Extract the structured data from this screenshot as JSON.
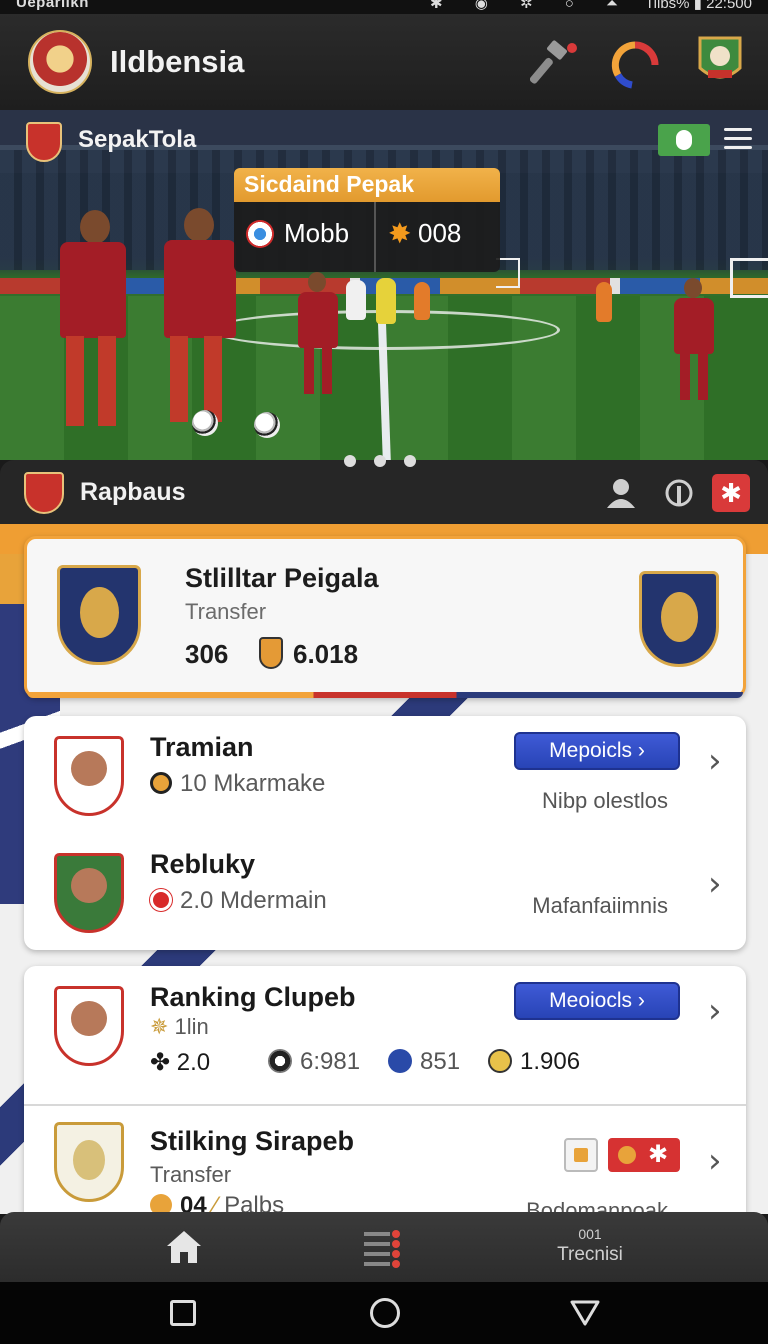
{
  "status_bar": {
    "carrier": "Uepariikn",
    "battery": "Tiibs%",
    "time": "22:500"
  },
  "header": {
    "title": "Ildbensia"
  },
  "hero": {
    "brand": "SepakTola",
    "match_card": {
      "title": "Sicdaind Pepak",
      "team": "Mobb",
      "score": "008"
    },
    "slide_count": 3
  },
  "section": {
    "title": "Rapbaus"
  },
  "featured": {
    "title": "Stlilltar Peigala",
    "subtitle": "Transfer",
    "count": "306",
    "value": "6.018"
  },
  "list": [
    {
      "title": "Tramian",
      "meta": "10 Mkarmake",
      "button": "Mepoicls  ›",
      "right_text": "Nibp olestlos"
    },
    {
      "title": "Rebluky",
      "meta": "2.0  Mdermain",
      "right_text": "Mafanfaiimnis"
    }
  ],
  "ranking": {
    "title": "Ranking Clupeb",
    "sub": "1lin",
    "button": "Meoiocls  ›",
    "stats": [
      "2.0",
      "6:981",
      "851",
      "1.906"
    ]
  },
  "striking": {
    "title": "Stilking Sirapeb",
    "subtitle": "Transfer",
    "value": "04",
    "partial_label": "Palbs",
    "right_text": "Bodomanpoak"
  },
  "bottom_nav": {
    "tab3_small": "001",
    "tab3_label": "Trecnisi"
  },
  "colors": {
    "accent_orange": "#f2a33a",
    "button_blue": "#2f4ccc",
    "brand_red": "#c8322b",
    "header_dark": "#262626"
  }
}
